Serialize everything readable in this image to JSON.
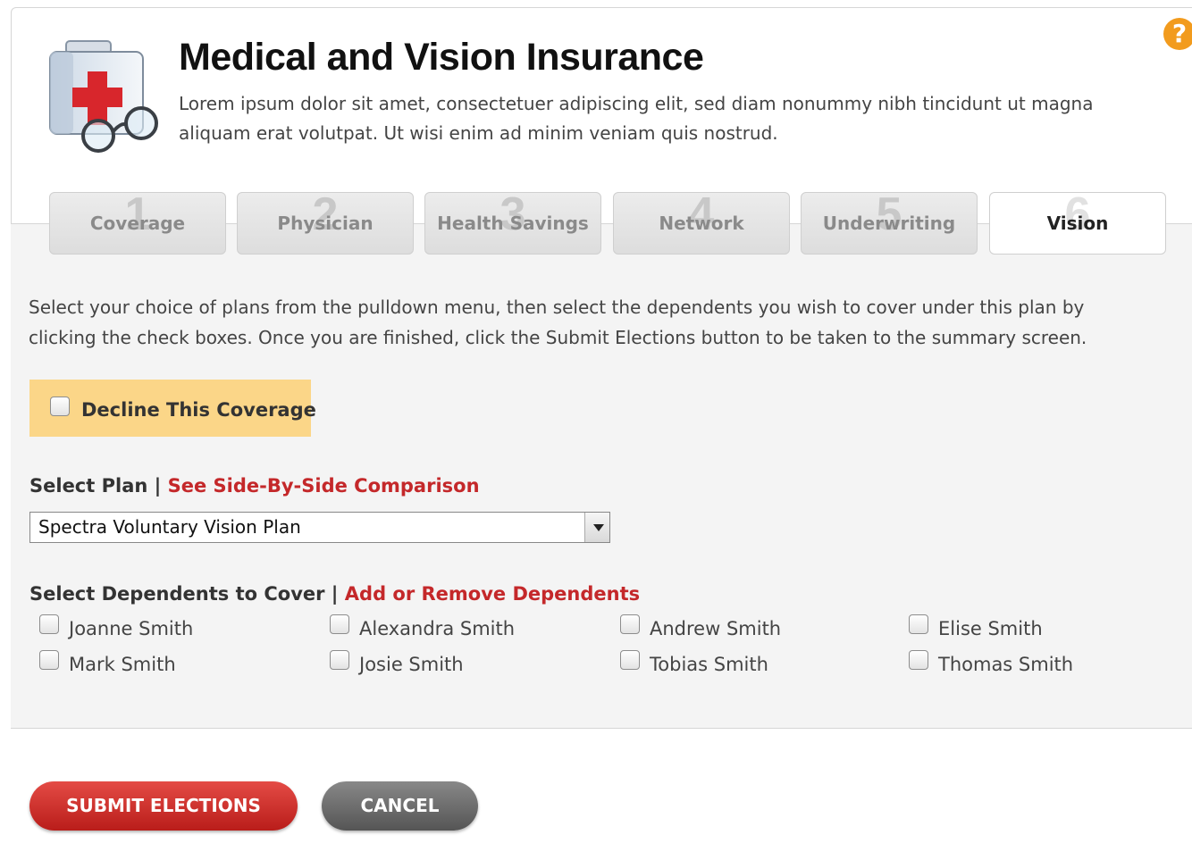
{
  "header": {
    "title": "Medical and Vision Insurance",
    "description": "Lorem ipsum dolor sit amet, consectetuer adipiscing elit, sed diam nonummy nibh tincidunt ut magna aliquam erat volutpat. Ut wisi enim ad minim veniam quis nostrud.",
    "help_glyph": "?"
  },
  "tabs": [
    {
      "num": "1",
      "label": "Coverage",
      "active": false
    },
    {
      "num": "2",
      "label": "Physician",
      "active": false
    },
    {
      "num": "3",
      "label": "Health Savings",
      "active": false
    },
    {
      "num": "4",
      "label": "Network",
      "active": false
    },
    {
      "num": "5",
      "label": "Underwriting",
      "active": false
    },
    {
      "num": "6",
      "label": "Vision",
      "active": true
    }
  ],
  "instructions": "Select your choice of plans from the pulldown menu, then select the dependents you wish to cover under this plan by clicking the check boxes. Once you are finished, click the Submit Elections button to be taken to the summary screen.",
  "decline": {
    "label": "Decline This Coverage",
    "checked": false
  },
  "plan": {
    "label": "Select Plan",
    "separator": "|",
    "comparison_link": "See Side-By-Side Comparison",
    "selected": "Spectra Voluntary Vision Plan"
  },
  "dependents": {
    "label": "Select Dependents to Cover",
    "separator": "|",
    "manage_link": "Add or Remove Dependents",
    "people": [
      {
        "name": "Joanne Smith",
        "checked": false
      },
      {
        "name": "Mark Smith",
        "checked": false
      },
      {
        "name": "Alexandra Smith",
        "checked": false
      },
      {
        "name": "Josie Smith",
        "checked": false
      },
      {
        "name": "Andrew Smith",
        "checked": false
      },
      {
        "name": "Tobias Smith",
        "checked": false
      },
      {
        "name": "Elise Smith",
        "checked": false
      },
      {
        "name": "Thomas Smith",
        "checked": false
      }
    ]
  },
  "actions": {
    "submit_label": "SUBMIT ELECTIONS",
    "cancel_label": "CANCEL"
  },
  "colors": {
    "accent_red": "#c4282a",
    "decline_bg": "#fbd688",
    "help_orange": "#f29b1d"
  },
  "icons": {
    "app_icon": "medical-kit-icon",
    "help_icon": "help-icon"
  }
}
